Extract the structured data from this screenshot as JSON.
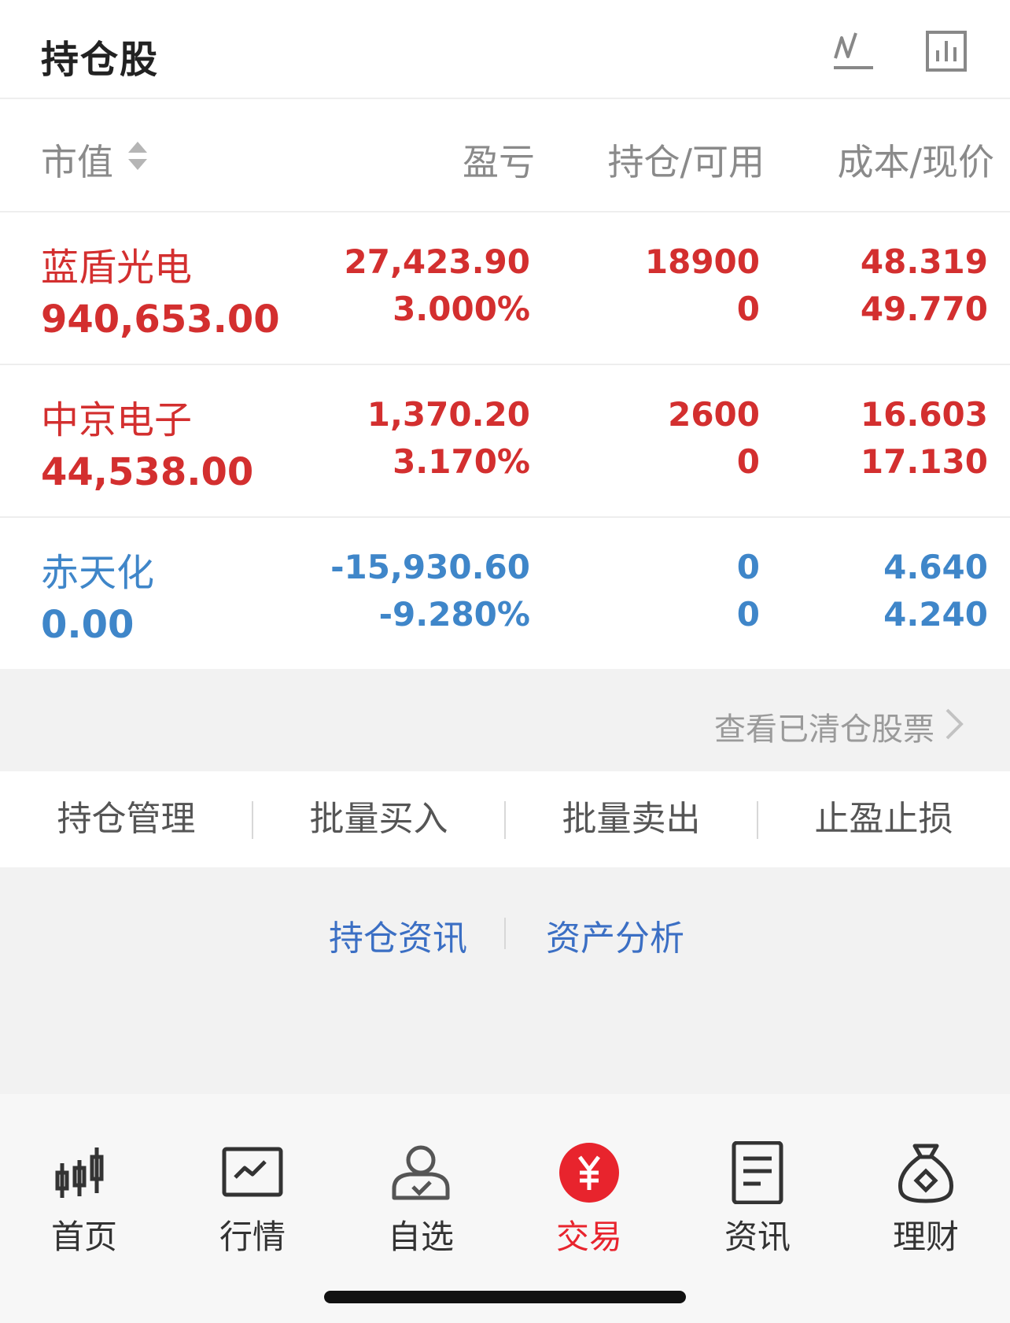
{
  "header": {
    "title": "持仓股",
    "icons": [
      "trend-chart-icon",
      "bar-chart-icon"
    ]
  },
  "columns": {
    "market_value": "市值",
    "profit_loss": "盈亏",
    "position_available": "持仓/可用",
    "cost_price": "成本/现价"
  },
  "holdings": [
    {
      "name": "蓝盾光电",
      "market_value": "940,653.00",
      "pl_amount": "27,423.90",
      "pl_percent": "3.000%",
      "position": "18900",
      "available": "0",
      "cost": "48.319",
      "price": "49.770"
    },
    {
      "name": "中京电子",
      "market_value": "44,538.00",
      "pl_amount": "1,370.20",
      "pl_percent": "3.170%",
      "position": "2600",
      "available": "0",
      "cost": "16.603",
      "price": "17.130"
    },
    {
      "name": "赤天化",
      "market_value": "0.00",
      "pl_amount": "-15,930.60",
      "pl_percent": "-9.280%",
      "position": "0",
      "available": "0",
      "cost": "4.640",
      "price": "4.240"
    }
  ],
  "cleared_link": "查看已清仓股票",
  "actions": [
    "持仓管理",
    "批量买入",
    "批量卖出",
    "止盈止损"
  ],
  "links": [
    "持仓资讯",
    "资产分析"
  ],
  "tabbar": [
    {
      "label": "首页",
      "icon": "candlestick-icon"
    },
    {
      "label": "行情",
      "icon": "market-chart-icon"
    },
    {
      "label": "自选",
      "icon": "user-check-icon"
    },
    {
      "label": "交易",
      "icon": "yuan-icon",
      "active": true
    },
    {
      "label": "资讯",
      "icon": "document-icon"
    },
    {
      "label": "理财",
      "icon": "money-bag-icon"
    }
  ],
  "colors": {
    "up": "#d32f2f",
    "down": "#3f86c9",
    "active_tab": "#e8242d",
    "link": "#3b6fc4"
  }
}
